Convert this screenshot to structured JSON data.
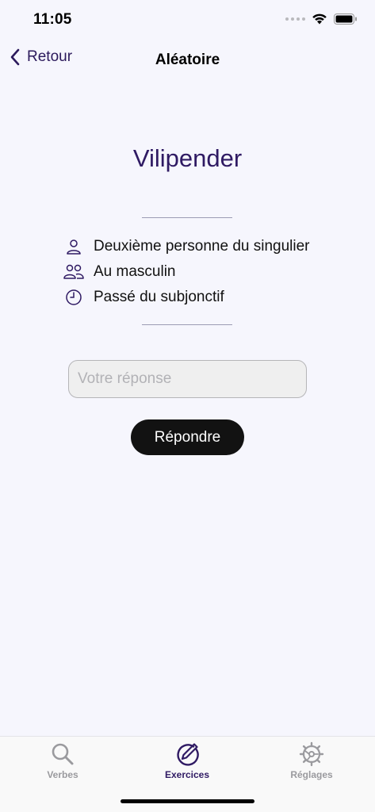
{
  "status_bar": {
    "time": "11:05"
  },
  "nav": {
    "back_label": "Retour",
    "title": "Aléatoire"
  },
  "exercise": {
    "verb": "Vilipender",
    "details": [
      {
        "icon": "person-icon",
        "text": "Deuxième personne du singulier"
      },
      {
        "icon": "people-icon",
        "text": "Au masculin"
      },
      {
        "icon": "clock-icon",
        "text": "Passé du subjonctif"
      }
    ],
    "answer_placeholder": "Votre réponse",
    "answer_value": "",
    "submit_label": "Répondre"
  },
  "tab_bar": {
    "tabs": [
      {
        "label": "Verbes",
        "icon": "search-icon",
        "active": false
      },
      {
        "label": "Exercices",
        "icon": "pencil-circle-icon",
        "active": true
      },
      {
        "label": "Réglages",
        "icon": "gear-icon",
        "active": false
      }
    ]
  },
  "colors": {
    "accent": "#2f1a63",
    "background": "#f6f6fd",
    "button": "#121212",
    "inactive_tab": "#9a9a9e"
  }
}
